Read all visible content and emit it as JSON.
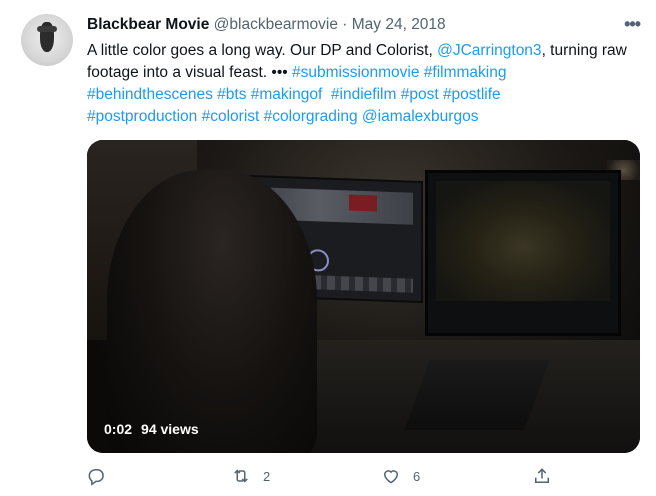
{
  "author": {
    "display_name": "Blackbear Movie",
    "handle": "@blackbearmovie",
    "separator": "·",
    "date": "May 24, 2018"
  },
  "more_label": "•••",
  "text": {
    "part1": "A little color goes a long way.  Our DP and Colorist, ",
    "mention": "@JCarrington3",
    "part2": ", turning raw footage into a visual feast. ••• ",
    "hashtags": [
      "#submissionmovie",
      "#filmmaking",
      "#behindthescenes",
      "#bts",
      "#makingof",
      "#indiefilm",
      "#post",
      "#postlife",
      "#postproduction",
      "#colorist",
      "#colorgrading"
    ],
    "mention2": "@iamalexburgos"
  },
  "video": {
    "time": "0:02",
    "views": "94 views"
  },
  "actions": {
    "reply_icon": "reply-icon",
    "retweet_count": "2",
    "like_count": "6",
    "share_icon": "share-icon"
  },
  "colors": {
    "link": "#1d9bf0",
    "secondary_text": "#536471",
    "primary_text": "#0f1419"
  }
}
